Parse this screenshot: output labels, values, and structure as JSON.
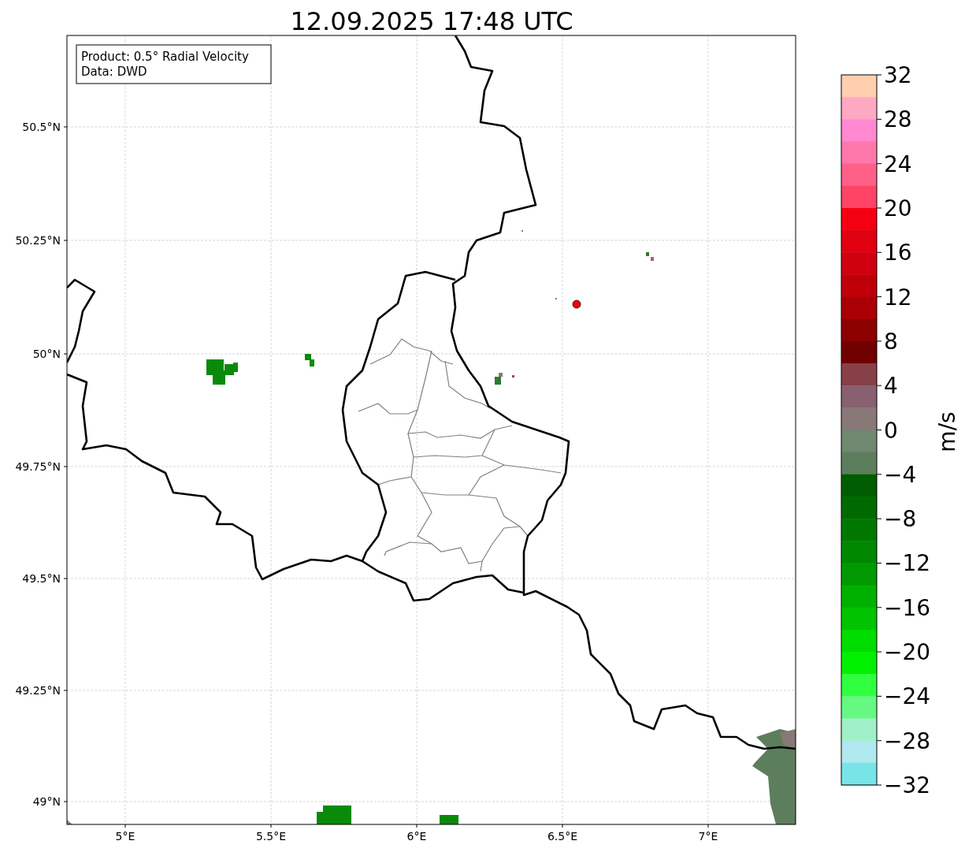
{
  "title": "12.09.2025 17:48 UTC",
  "info_box": {
    "lines": [
      "Product: 0.5° Radial Velocity",
      "Data: DWD"
    ]
  },
  "map": {
    "lat_ticks": [
      "50.5°N",
      "50.25°N",
      "50°N",
      "49.75°N",
      "49.5°N",
      "49.25°N",
      "49°N"
    ],
    "lon_ticks": [
      "5°E",
      "5.5°E",
      "6°E",
      "6.5°E",
      "7°E"
    ]
  },
  "colorbar": {
    "label": "m/s",
    "ticks": [
      "32",
      "28",
      "24",
      "20",
      "16",
      "12",
      "8",
      "4",
      "0",
      "−4",
      "−8",
      "−12",
      "−16",
      "−20",
      "−24",
      "−28",
      "−32"
    ],
    "segments": [
      {
        "color": "#ffcfb0"
      },
      {
        "color": "#ffa8c4"
      },
      {
        "color": "#ff88d0"
      },
      {
        "color": "#ff77aa"
      },
      {
        "color": "#ff6088"
      },
      {
        "color": "#ff4466"
      },
      {
        "color": "#f50010"
      },
      {
        "color": "#e0000f"
      },
      {
        "color": "#d00010"
      },
      {
        "color": "#c00008"
      },
      {
        "color": "#aa0005"
      },
      {
        "color": "#8c0000"
      },
      {
        "color": "#700000"
      },
      {
        "color": "#884048"
      },
      {
        "color": "#886070"
      },
      {
        "color": "#887878"
      },
      {
        "color": "#708870"
      },
      {
        "color": "#5c7e5c"
      },
      {
        "color": "#005c00"
      },
      {
        "color": "#006a00"
      },
      {
        "color": "#007800"
      },
      {
        "color": "#008800"
      },
      {
        "color": "#009a00"
      },
      {
        "color": "#00b000"
      },
      {
        "color": "#00c400"
      },
      {
        "color": "#00dc00"
      },
      {
        "color": "#00f000"
      },
      {
        "color": "#30ff40"
      },
      {
        "color": "#66f880"
      },
      {
        "color": "#a0f0c8"
      },
      {
        "color": "#b0e8f0"
      },
      {
        "color": "#78e4e8"
      }
    ]
  }
}
